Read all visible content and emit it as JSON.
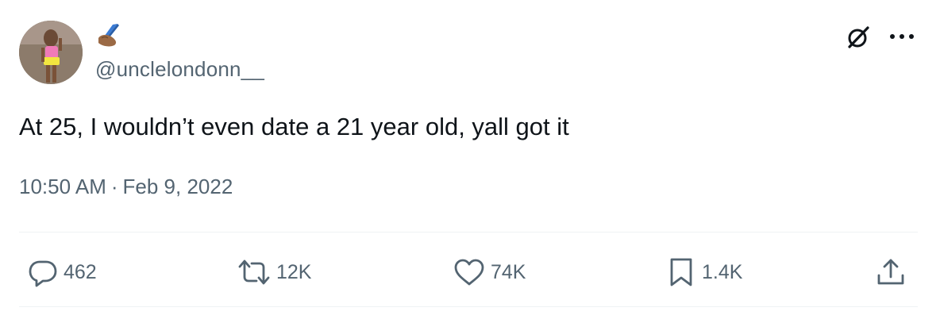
{
  "author": {
    "display_name_emoji": "writing-hand-emoji",
    "handle": "@unclelondonn__"
  },
  "tweet": {
    "text": "At 25, I wouldn’t even date a 21 year old, yall got it",
    "time": "10:50 AM",
    "separator": "·",
    "date": "Feb 9, 2022"
  },
  "header_icons": {
    "grok": "grok-icon",
    "more": "more-icon"
  },
  "actions": {
    "replies": "462",
    "retweets": "12K",
    "likes": "74K",
    "bookmarks": "1.4K"
  },
  "colors": {
    "text_primary": "#0f1419",
    "text_secondary": "#536471",
    "divider": "#eff3f4"
  }
}
